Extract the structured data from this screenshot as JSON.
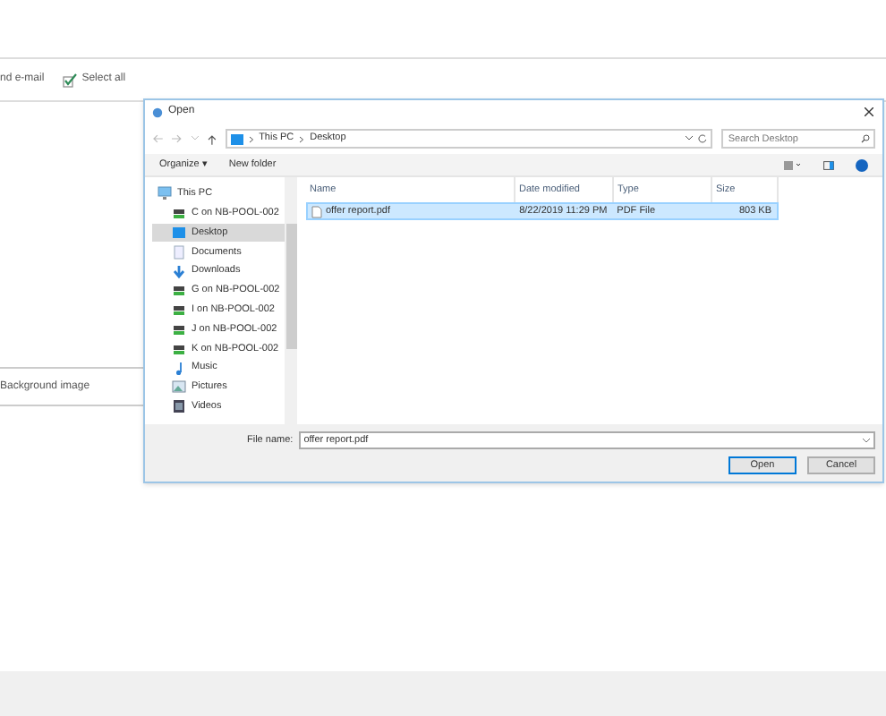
{
  "app_toolbar": [
    {
      "kind": "email",
      "label": "nd e-mail"
    },
    {
      "kind": "select",
      "label": "Select all"
    }
  ],
  "app_panel": {
    "label": "Background image"
  },
  "dialog": {
    "title": "Open",
    "breadcrumb": [
      "This PC",
      "Desktop"
    ],
    "search": {
      "placeholder": "Search Desktop"
    },
    "toolbar": {
      "organize": "Organize ▾",
      "new_folder": "New folder"
    },
    "nav": [
      {
        "kind": "pc",
        "label": "This PC",
        "selected": false
      },
      {
        "kind": "drive",
        "label": "C on NB-POOL-002",
        "selected": false
      },
      {
        "kind": "desktop",
        "label": "Desktop",
        "selected": true
      },
      {
        "kind": "documents",
        "label": "Documents",
        "selected": false
      },
      {
        "kind": "downloads",
        "label": "Downloads",
        "selected": false
      },
      {
        "kind": "drive",
        "label": "G on NB-POOL-002",
        "selected": false
      },
      {
        "kind": "drive",
        "label": "I on NB-POOL-002",
        "selected": false
      },
      {
        "kind": "drive",
        "label": "J on NB-POOL-002",
        "selected": false
      },
      {
        "kind": "drive",
        "label": "K on NB-POOL-002",
        "selected": false
      },
      {
        "kind": "music",
        "label": "Music",
        "selected": false
      },
      {
        "kind": "pictures",
        "label": "Pictures",
        "selected": false
      },
      {
        "kind": "videos",
        "label": "Videos",
        "selected": false
      }
    ],
    "columns": [
      "Name",
      "Date modified",
      "Type",
      "Size"
    ],
    "rows": [
      {
        "cells": [
          "offer report.pdf",
          "8/22/2019 11:29 PM",
          "PDF File",
          "803 KB"
        ],
        "selected": true
      }
    ],
    "file_name": {
      "label": "File name:",
      "value": "offer report.pdf"
    },
    "buttons": {
      "open": "Open",
      "cancel": "Cancel"
    }
  }
}
